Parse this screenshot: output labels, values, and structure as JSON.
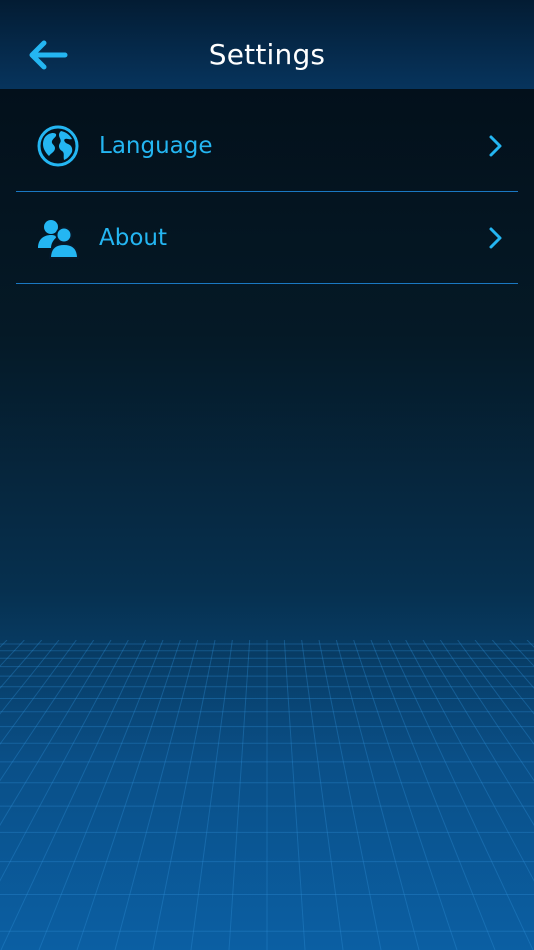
{
  "header": {
    "title": "Settings",
    "back_icon": "arrow-left-icon"
  },
  "menu": {
    "items": [
      {
        "id": "language",
        "label": "Language",
        "icon": "globe-icon",
        "trailing_icon": "chevron-right-icon"
      },
      {
        "id": "about",
        "label": "About",
        "icon": "users-icon",
        "trailing_icon": "chevron-right-icon"
      }
    ]
  },
  "colors": {
    "accent": "#24b6f2",
    "divider": "#1a78c2",
    "header_bg": "#07345d",
    "title_text": "#ffffff"
  }
}
